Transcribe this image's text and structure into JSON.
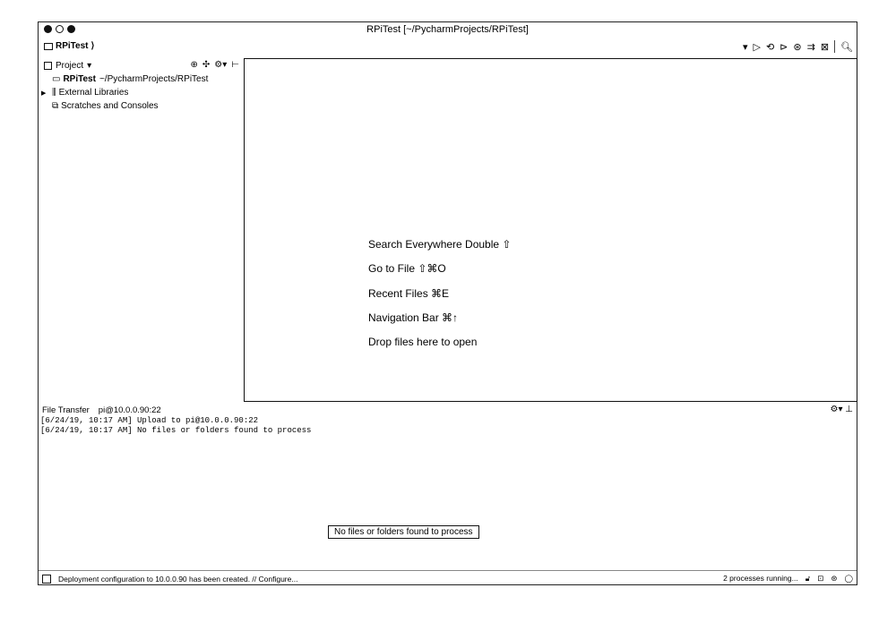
{
  "window": {
    "title": "RPiTest [~/PycharmProjects/RPiTest]"
  },
  "navbar": {
    "breadcrumb": "RPiTest",
    "breadcrumb_sep": "⟩"
  },
  "project_panel": {
    "title": "Project",
    "tree": [
      {
        "label": "RPiTest",
        "path": "~/PycharmProjects/RPiTest",
        "expanded": true
      },
      {
        "label": "External Libraries",
        "expanded": false
      },
      {
        "label": "Scratches and Consoles"
      }
    ]
  },
  "editor": {
    "hints": [
      "Search Everywhere Double ⇧",
      "Go to File ⇧⌘O",
      "Recent Files ⌘E",
      "Navigation Bar ⌘↑",
      "Drop files here to open"
    ]
  },
  "file_transfer": {
    "title": "File Transfer",
    "host": "pi@10.0.0.90:22",
    "log": [
      "[6/24/19, 10:17 AM] Upload to pi@10.0.0.90:22",
      "[6/24/19, 10:17 AM] No files or folders found to process"
    ]
  },
  "tooltip": "No files or folders found to process",
  "statusbar": {
    "message": "Deployment configuration to 10.0.0.90 has been created. // Configure...",
    "processes": "2 processes running..."
  },
  "icons": [
    "search-icon",
    "settings-icon",
    "hide-icon",
    "run-icon",
    "debug-icon"
  ]
}
